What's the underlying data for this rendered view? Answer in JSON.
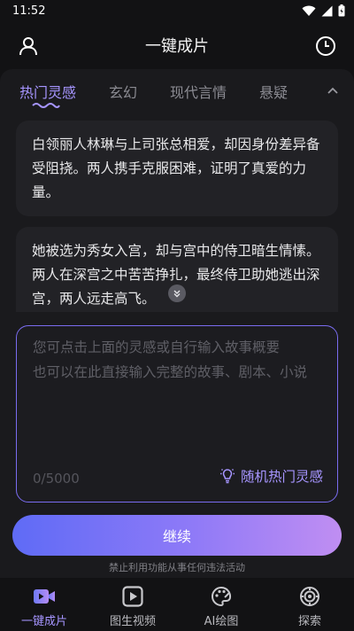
{
  "status_bar": {
    "time": "11:52"
  },
  "header": {
    "title": "一键成片"
  },
  "tabs": [
    {
      "label": "热门灵感",
      "active": true
    },
    {
      "label": "玄幻",
      "active": false
    },
    {
      "label": "现代言情",
      "active": false
    },
    {
      "label": "悬疑",
      "active": false
    }
  ],
  "idea_cards": [
    {
      "text": "白领丽人林琳与上司张总相爱，却因身份差异备受阻挠。两人携手克服困难，证明了真爱的力量。"
    },
    {
      "text": "她被选为秀女入宫，却与宫中的侍卫暗生情愫。两人在深宫之中苦苦挣扎，最终侍卫助她逃出深宫，两人远走高飞。"
    }
  ],
  "story_input": {
    "placeholder_line1": "您可点击上面的灵感或自行输入故事概要",
    "placeholder_line2": "也可以在此直接输入完整的故事、剧本、小说",
    "char_count": "0/5000",
    "random_label": "随机热门灵感"
  },
  "continue_button": {
    "label": "继续"
  },
  "disclaimer": "禁止利用功能从事任何违法活动",
  "bottom_nav": [
    {
      "label": "一键成片",
      "icon": "video-camera-icon",
      "active": true
    },
    {
      "label": "图生视频",
      "icon": "play-square-icon",
      "active": false
    },
    {
      "label": "AI绘图",
      "icon": "palette-icon",
      "active": false
    },
    {
      "label": "探索",
      "icon": "compass-icon",
      "active": false
    }
  ],
  "colors": {
    "accent": "#a695ff",
    "background": "#121214",
    "card": "#222226",
    "gradient_start": "#5f6bf6",
    "gradient_end": "#c08ef2"
  }
}
